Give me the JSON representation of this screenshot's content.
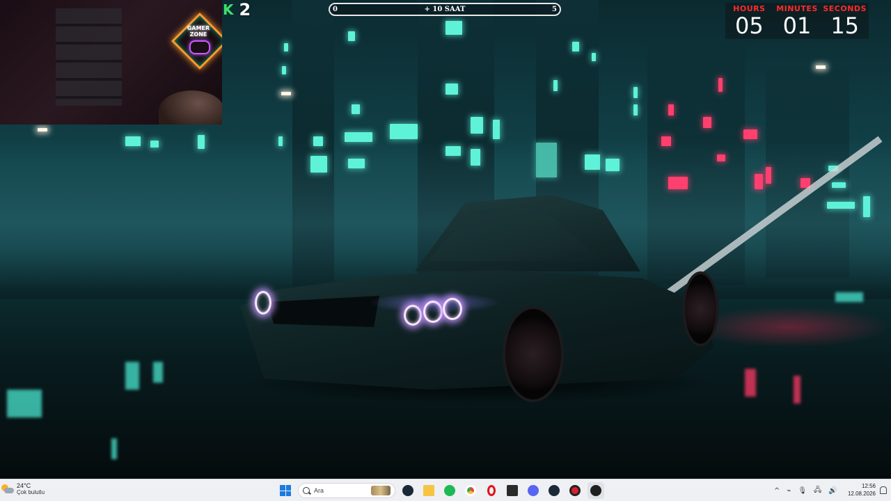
{
  "overlay": {
    "kill_count": "2",
    "kick_logo": "K",
    "subathon_bar": {
      "left": "0",
      "center": "+ 10 SAAT",
      "right": "5",
      "progress": 0.0
    },
    "timer": {
      "hours_label": "HOURS",
      "hours": "05",
      "minutes_label": "MINUTES",
      "minutes": "01",
      "seconds_label": "SECONDS",
      "seconds": "15"
    },
    "colors": {
      "timer_label": "#ff2b2b",
      "kick_green": "#3ee06a"
    }
  },
  "webcam": {
    "sign_line1": "GAMER",
    "sign_line2": "ZONE"
  },
  "taskbar": {
    "weather": {
      "temp": "24°C",
      "condition": "Çok bulutlu",
      "icon": "partly-cloudy-icon"
    },
    "search_placeholder": "Ara",
    "pinned_apps": [
      {
        "name": "steam",
        "color": "#1b2838"
      },
      {
        "name": "file-explorer",
        "color": "#f5c542"
      },
      {
        "name": "spotify",
        "color": "#1db954"
      },
      {
        "name": "chrome",
        "color": "#e8453c"
      },
      {
        "name": "opera",
        "color": "#e3101e"
      },
      {
        "name": "epic-games",
        "color": "#2a2a2a"
      },
      {
        "name": "discord",
        "color": "#5865f2"
      },
      {
        "name": "steam-2",
        "color": "#1b2838"
      },
      {
        "name": "app-red",
        "color": "#d6222e"
      },
      {
        "name": "app-active",
        "color": "#1f1f1f"
      }
    ],
    "tray_icons": [
      "^",
      "⌁",
      "🎙",
      "🖧",
      "🔊"
    ],
    "time": "12:56",
    "date": "12.08.2026"
  }
}
